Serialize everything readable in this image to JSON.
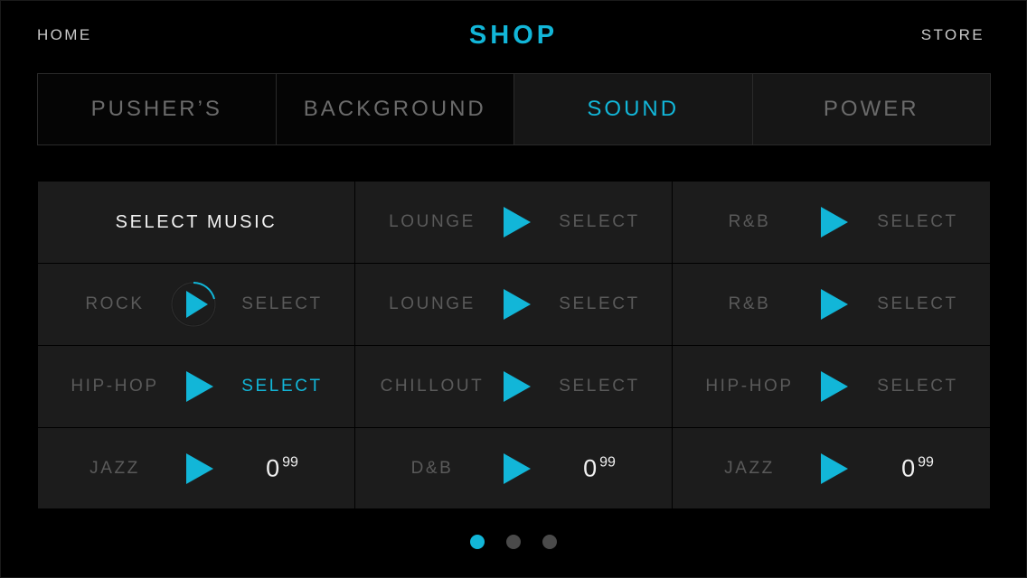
{
  "header": {
    "home_label": "HOME",
    "title": "SHOP",
    "store_label": "STORE"
  },
  "tabs": [
    {
      "label": "PUSHER’S",
      "active": false
    },
    {
      "label": "BACKGROUND",
      "active": false
    },
    {
      "label": "SOUND",
      "active": true
    },
    {
      "label": "POWER",
      "active": false
    }
  ],
  "grid": {
    "header_label": "SELECT MUSIC",
    "rows": [
      [
        {
          "type": "header"
        },
        {
          "genre": "LOUNGE",
          "action": "SELECT",
          "selected": false
        },
        {
          "genre": "R&B",
          "action": "SELECT",
          "selected": false
        }
      ],
      [
        {
          "genre": "ROCK",
          "action": "SELECT",
          "selected": false,
          "playing": true
        },
        {
          "genre": "LOUNGE",
          "action": "SELECT",
          "selected": false
        },
        {
          "genre": "R&B",
          "action": "SELECT",
          "selected": false
        }
      ],
      [
        {
          "genre": "HIP-HOP",
          "action": "SELECT",
          "selected": true
        },
        {
          "genre": "CHILLOUT",
          "action": "SELECT",
          "selected": false
        },
        {
          "genre": "HIP-HOP",
          "action": "SELECT",
          "selected": false
        }
      ],
      [
        {
          "genre": "JAZZ",
          "price_main": "0",
          "price_cents": "99"
        },
        {
          "genre": "D&B",
          "price_main": "0",
          "price_cents": "99"
        },
        {
          "genre": "JAZZ",
          "price_main": "0",
          "price_cents": "99"
        }
      ]
    ]
  },
  "pagination": {
    "pages": 3,
    "current": 1
  },
  "colors": {
    "accent": "#12b6d8",
    "background": "#000000",
    "cell": "#1c1c1c",
    "muted_text": "#5a5a5a"
  },
  "icons": {
    "play": "play-triangle-icon",
    "play_progress": "play-progress-ring-icon"
  }
}
